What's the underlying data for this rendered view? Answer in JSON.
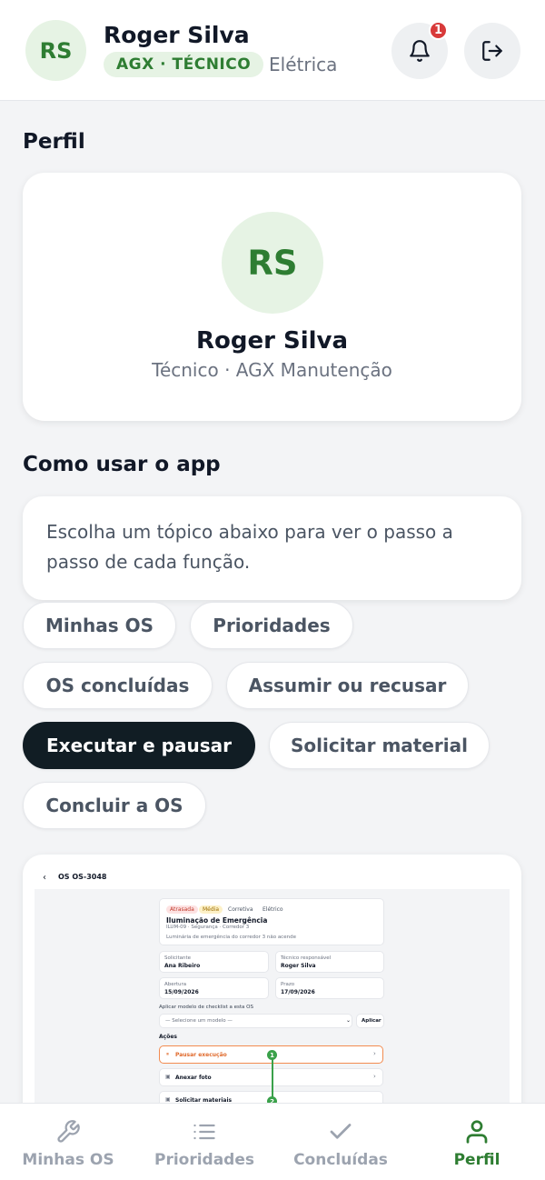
{
  "header": {
    "initials": "RS",
    "name": "Roger Silva",
    "badge": "AGX · TÉCNICO",
    "area": "Elétrica",
    "notification_count": "1",
    "bell_icon": "bell-icon",
    "logout_icon": "logout-icon"
  },
  "profile": {
    "section_title": "Perfil",
    "initials": "RS",
    "name": "Roger Silva",
    "role": "Técnico · AGX Manutenção"
  },
  "help": {
    "section_title": "Como usar o app",
    "intro": "Escolha um tópico abaixo para ver o passo a passo de cada função.",
    "topics": [
      {
        "label": "Minhas OS",
        "active": false
      },
      {
        "label": "Prioridades",
        "active": false
      },
      {
        "label": "OS concluídas",
        "active": false
      },
      {
        "label": "Assumir ou recusar",
        "active": false
      },
      {
        "label": "Executar e pausar",
        "active": true
      },
      {
        "label": "Solicitar material",
        "active": false
      },
      {
        "label": "Concluir a OS",
        "active": false
      }
    ]
  },
  "preview": {
    "title": "OS OS-3048",
    "tags": [
      "Atrasada",
      "Média",
      "Corretiva",
      "Elétrico"
    ],
    "os_name": "Iluminação de Emergência",
    "os_sub": "ILUM-09 · Segurança · Corredor 3",
    "os_desc": "Luminária de emergência do corredor 3 não acende",
    "requester_label": "Solicitante",
    "requester": "Ana Ribeiro",
    "tech_label": "Técnico responsável",
    "tech": "Roger Silva",
    "opened_label": "Abertura",
    "opened": "15/09/2026",
    "due_label": "Prazo",
    "due": "17/09/2026",
    "checklist_label": "Aplicar modelo de checklist a esta OS",
    "checklist_placeholder": "— Selecione um modelo —",
    "apply_label": "Aplicar",
    "actions_label": "Ações",
    "action_pause": "Pausar execução",
    "action_photo": "Anexar foto",
    "action_material": "Solicitar materiais",
    "step_1": "1",
    "step_2": "2"
  },
  "nav": {
    "items": [
      {
        "label": "Minhas OS",
        "icon": "wrench-icon"
      },
      {
        "label": "Prioridades",
        "icon": "list-icon"
      },
      {
        "label": "Concluídas",
        "icon": "check-icon"
      },
      {
        "label": "Perfil",
        "icon": "user-icon"
      }
    ],
    "active": "Perfil"
  },
  "colors": {
    "accent": "#2e7d32",
    "accent_bg": "#e6f3e4",
    "dark": "#111d24",
    "alert": "#d83a3a"
  }
}
